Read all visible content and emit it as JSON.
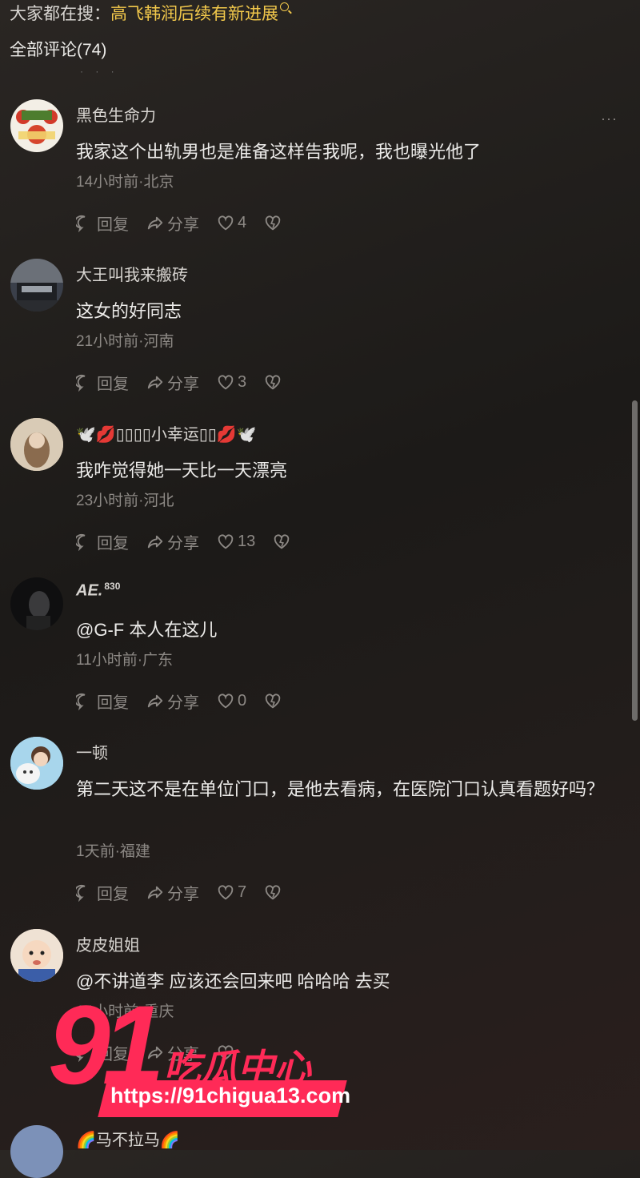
{
  "header": {
    "hot_search_label": "大家都在搜：",
    "hot_search_topic": "高飞韩润后续有新进展",
    "comment_count": "全部评论(74)"
  },
  "actions_labels": {
    "reply": "回复",
    "share": "分享"
  },
  "comments": [
    {
      "username": "黑色生命力",
      "content": "我家这个出轨男也是准备这样告我呢，我也曝光他了",
      "meta": "14小时前·北京",
      "likes": "4"
    },
    {
      "username": "大王叫我来搬砖",
      "content": "这女的好同志",
      "meta": "21小时前·河南",
      "likes": "3"
    },
    {
      "username": "🕊️💋▯▯▯▯小幸运▯▯💋🕊️",
      "content": "我咋觉得她一天比一天漂亮",
      "meta": "23小时前·河北",
      "likes": "13"
    },
    {
      "username": "AE.",
      "username_sup": "830",
      "content": "@G-F 本人在这儿",
      "meta": "11小时前·广东",
      "likes": "0"
    },
    {
      "username": "一顿",
      "content": "第二天这不是在单位门口，是他去看病，在医院门口认真看题好吗？",
      "meta": "1天前·福建",
      "likes": "7"
    },
    {
      "username": "皮皮姐姐",
      "content": "@不讲道李 应该还会回来吧 哈哈哈 去买",
      "meta": "14小时前·重庆",
      "likes": ""
    }
  ],
  "last_comment": {
    "username": "🌈马不拉马🌈"
  },
  "watermark": {
    "number": "91",
    "name": "吃瓜中心",
    "url": "https://91chigua13.com"
  },
  "colors": {
    "topic": "#f2c84b",
    "watermark": "#ff2a57"
  },
  "icons": [
    "search-icon",
    "reply-icon",
    "share-icon",
    "like-icon",
    "dislike-icon",
    "more-icon"
  ]
}
